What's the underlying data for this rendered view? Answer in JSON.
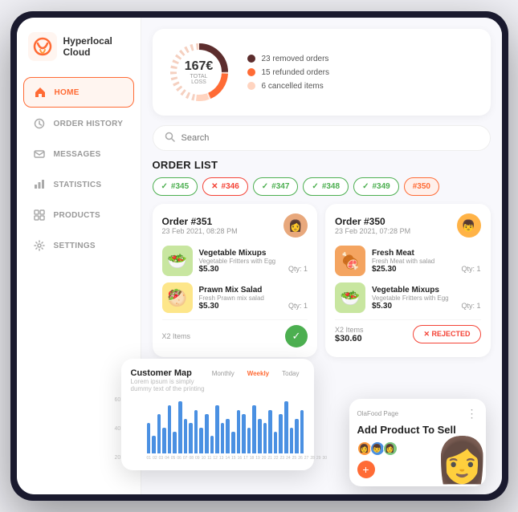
{
  "app": {
    "title": "Hyperlocal Cloud",
    "logo_text_line1": "Hyperlocal",
    "logo_text_line2": "Cloud"
  },
  "sidebar": {
    "items": [
      {
        "id": "home",
        "label": "HOME",
        "icon": "home",
        "active": true
      },
      {
        "id": "order-history",
        "label": "ORDER HISTORY",
        "icon": "clock",
        "active": false
      },
      {
        "id": "messages",
        "label": "MESSAGES",
        "icon": "mail",
        "active": false
      },
      {
        "id": "statistics",
        "label": "STATISTICS",
        "icon": "bar-chart",
        "active": false
      },
      {
        "id": "products",
        "label": "PRODUCTS",
        "icon": "grid",
        "active": false
      },
      {
        "id": "settings",
        "label": "SETTINGS",
        "icon": "settings",
        "active": false
      }
    ]
  },
  "stats": {
    "total_loss_value": "167€",
    "total_loss_label": "TOTAL LOSS",
    "legend": [
      {
        "color": "#5c2d2d",
        "label": "23 removed orders"
      },
      {
        "color": "#ff6b35",
        "label": "15 refunded orders"
      },
      {
        "color": "#ffd4c0",
        "label": "6 cancelled items"
      }
    ]
  },
  "search": {
    "placeholder": "Search"
  },
  "order_list": {
    "title": "ORDER LIST",
    "tabs": [
      {
        "id": "345",
        "label": "#345",
        "type": "check-green"
      },
      {
        "id": "346",
        "label": "#346",
        "type": "x-red"
      },
      {
        "id": "347",
        "label": "#347",
        "type": "check-green"
      },
      {
        "id": "348",
        "label": "#348",
        "type": "check-green"
      },
      {
        "id": "349",
        "label": "#349",
        "type": "check-green"
      },
      {
        "id": "350",
        "label": "#350",
        "type": "pink-active"
      }
    ]
  },
  "orders": [
    {
      "id": "order-351",
      "order_num": "Order #351",
      "date": "23 Feb 2021, 08:28 PM",
      "avatar": "👩",
      "items": [
        {
          "name": "Vegetable Mixups",
          "desc": "Vegetable Fritters with Egg",
          "price": "$5.30",
          "qty": "Qty: 1",
          "emoji": "🥗"
        },
        {
          "name": "Prawn Mix Salad",
          "desc": "Fresh Prawn mix salad",
          "price": "$5.30",
          "qty": "Qty: 1",
          "emoji": "🥙"
        }
      ],
      "items_count": "X2 Items",
      "total": "",
      "action": "check"
    },
    {
      "id": "order-350",
      "order_num": "Order #350",
      "date": "23 Feb 2021, 07:28 PM",
      "avatar": "👦",
      "items": [
        {
          "name": "Fresh Meat",
          "desc": "Fresh Meat with salad",
          "price": "$25.30",
          "qty": "Qty: 1",
          "emoji": "🍖"
        },
        {
          "name": "Vegetable Mixups",
          "desc": "Vegetable Fritters with Egg",
          "price": "$5.30",
          "qty": "Qty: 1",
          "emoji": "🥗"
        }
      ],
      "items_count": "X2 Items",
      "total": "$30.60",
      "action": "reject",
      "reject_label": "✕  REJECTED"
    }
  ],
  "customer_map": {
    "title": "Customer Map",
    "subtitle": "Lorem ipsum is simply dummy text of the printing",
    "periods": [
      "Monthly",
      "Weekly",
      "Today"
    ],
    "active_period": "Weekly",
    "y_labels": [
      "60",
      "40",
      "20"
    ],
    "bars": [
      35,
      20,
      45,
      30,
      55,
      25,
      60,
      40,
      35,
      50,
      30,
      45,
      20,
      55,
      35,
      40,
      25,
      50,
      45,
      30,
      55,
      40,
      35,
      50,
      25,
      45,
      60,
      30,
      40,
      50
    ],
    "x_labels": [
      "01",
      "02",
      "03",
      "04",
      "05",
      "06",
      "07",
      "08",
      "09",
      "10",
      "11",
      "12",
      "13",
      "14",
      "15",
      "16",
      "17",
      "18",
      "19",
      "20",
      "21",
      "22",
      "23",
      "24",
      "25",
      "26",
      "27",
      "28",
      "29",
      "30"
    ]
  },
  "add_product": {
    "source": "OlaFood Page",
    "title": "Add Product To Sell",
    "add_btn_label": "+",
    "illustration": "👩"
  }
}
